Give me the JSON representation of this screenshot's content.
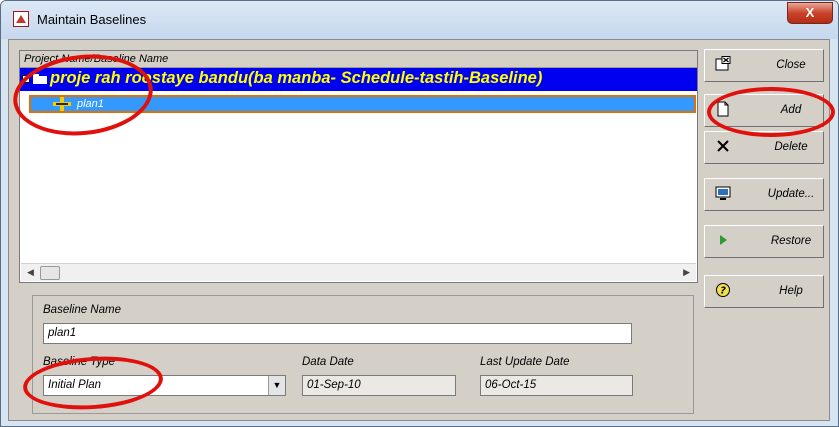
{
  "window": {
    "title": "Maintain Baselines",
    "close_glyph": "X"
  },
  "tree": {
    "header": "Project Name/Baseline Name",
    "project_label": "proje rah roostaye bandu(ba manba- Schedule-tastih-Baseline)",
    "baseline_label": "plan1"
  },
  "form": {
    "baseline_name_label": "Baseline Name",
    "baseline_name_value": "plan1",
    "baseline_type_label": "Baseline Type",
    "baseline_type_value": "Initial Plan",
    "data_date_label": "Data Date",
    "data_date_value": "01-Sep-10",
    "last_update_label": "Last Update Date",
    "last_update_value": "06-Oct-15"
  },
  "buttons": {
    "close": "Close",
    "add": "Add",
    "delete": "Delete",
    "update": "Update...",
    "restore": "Restore",
    "help": "Help"
  },
  "colors": {
    "annotation": "#e0100c",
    "project_row": "#0000f0",
    "selected_row": "#3399ff"
  }
}
